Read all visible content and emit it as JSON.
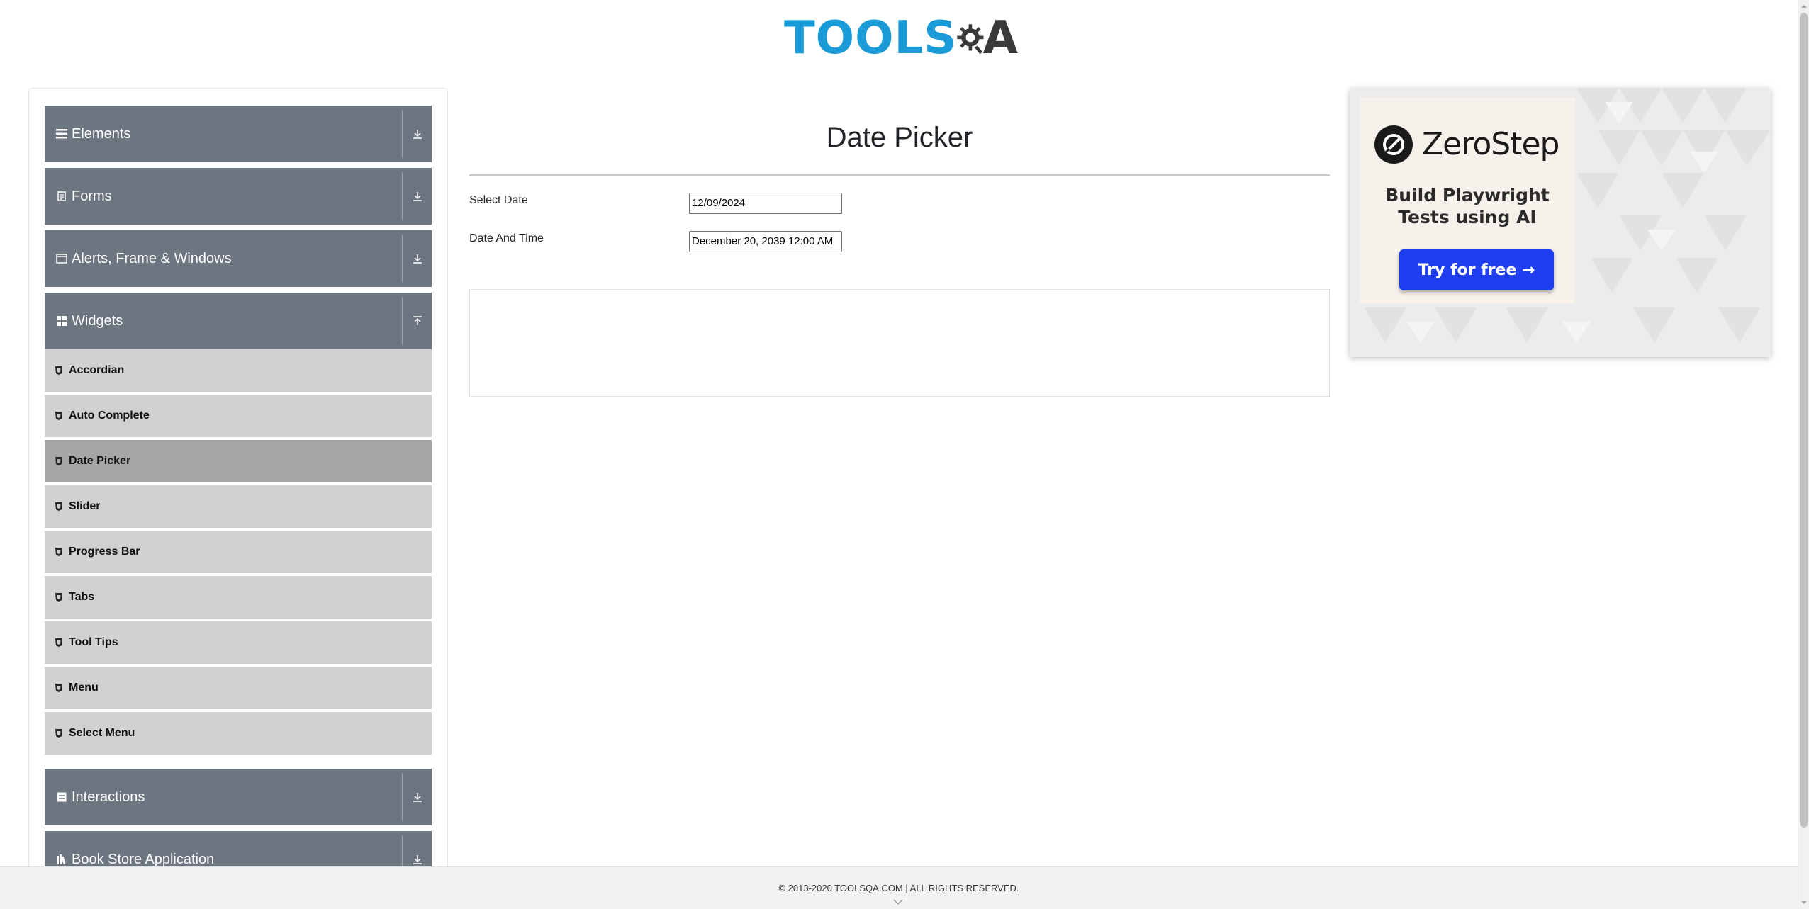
{
  "header": {
    "logo_text": "TOOLS",
    "logo_suffix": "A"
  },
  "sidebar": {
    "groups": [
      {
        "label": "Elements",
        "icon": "hamburger-icon"
      },
      {
        "label": "Forms",
        "icon": "form-icon"
      },
      {
        "label": "Alerts, Frame & Windows",
        "icon": "window-icon"
      },
      {
        "label": "Widgets",
        "icon": "widgets-icon",
        "expanded": true
      },
      {
        "label": "Interactions",
        "icon": "interactions-icon"
      },
      {
        "label": "Book Store Application",
        "icon": "bookstore-icon"
      }
    ],
    "widgets_items": [
      {
        "label": "Accordian"
      },
      {
        "label": "Auto Complete"
      },
      {
        "label": "Date Picker",
        "active": true
      },
      {
        "label": "Slider"
      },
      {
        "label": "Progress Bar"
      },
      {
        "label": "Tabs"
      },
      {
        "label": "Tool Tips"
      },
      {
        "label": "Menu"
      },
      {
        "label": "Select Menu"
      }
    ]
  },
  "main": {
    "title": "Date Picker",
    "select_date": {
      "label": "Select Date",
      "value": "12/09/2024"
    },
    "date_and_time": {
      "label": "Date And Time",
      "value": "December 20, 2039 12:00 AM"
    }
  },
  "ad": {
    "brand": "ZeroStep",
    "tagline_line1": "Build Playwright",
    "tagline_line2": "Tests using AI",
    "cta": "Try for free →"
  },
  "footer": {
    "copyright": "© 2013-2020 TOOLSQA.COM | ALL RIGHTS RESERVED."
  },
  "colors": {
    "sidebar_header": "#6c7580",
    "sidebar_item": "#d1d1d1",
    "sidebar_item_active": "#a6a6a6",
    "logo_blue": "#1a9bd7",
    "cta_blue": "#1e3ef0"
  }
}
